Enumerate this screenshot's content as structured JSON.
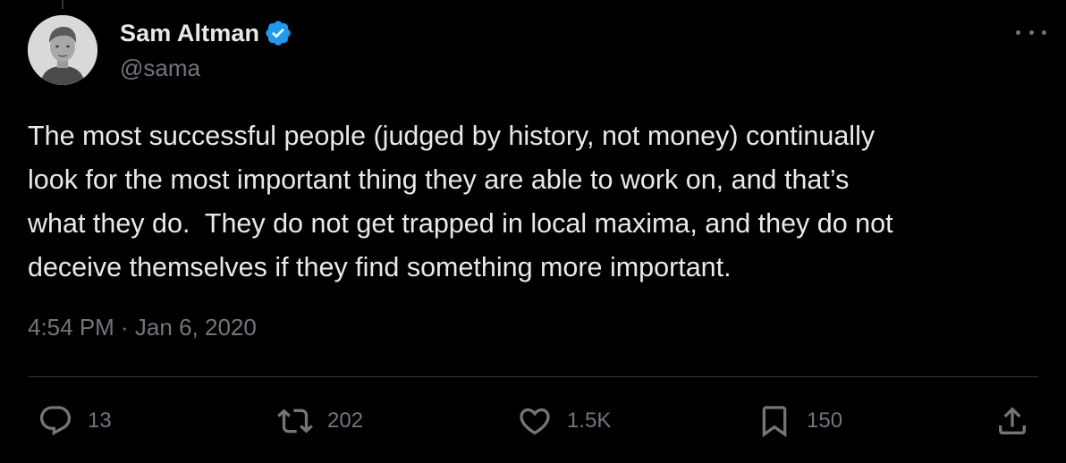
{
  "author": {
    "display_name": "Sam Altman",
    "handle": "@sama",
    "verified": true,
    "verified_color": "#1d9bf0"
  },
  "tweet": {
    "text": "The most successful people (judged by history, not money) continually\nlook for the most important thing they are able to work on, and that’s\nwhat they do.  They do not get trapped in local maxima, and they do not\ndeceive themselves if they find something more important.",
    "timestamp": "4:54 PM · Jan 6, 2020"
  },
  "actions": {
    "replies": "13",
    "retweets": "202",
    "likes": "1.5K",
    "bookmarks": "150"
  },
  "icons": {
    "reply": "reply-bubble-icon",
    "retweet": "retweet-icon",
    "like": "heart-icon",
    "bookmark": "bookmark-icon",
    "share": "share-icon",
    "more": "more-icon"
  },
  "colors": {
    "background": "#000000",
    "text_primary": "#e7e9ea",
    "text_secondary": "#71767b",
    "divider": "#2f3336"
  }
}
